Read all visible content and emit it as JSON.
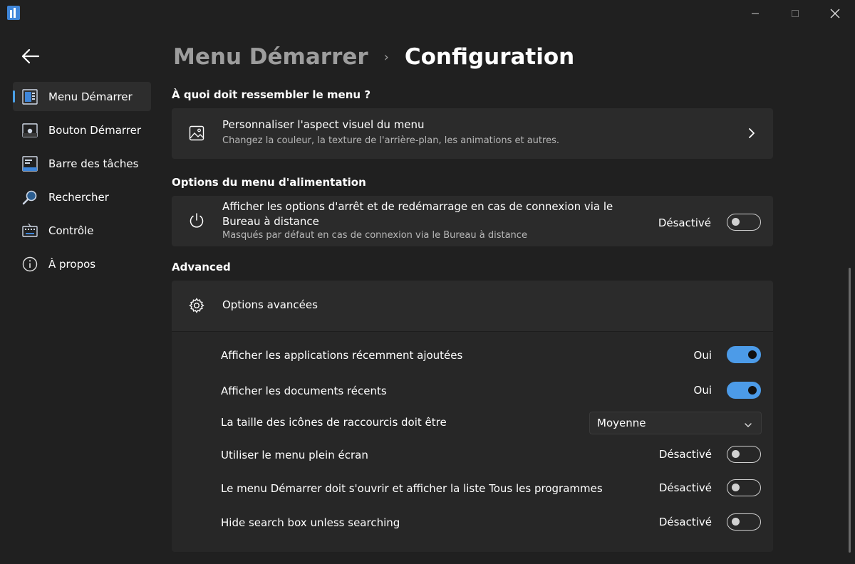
{
  "window": {
    "address_fragment": "https://... \\Startallback\\...",
    "controls": {
      "minimize": "minimize",
      "maximize": "maximize",
      "close": "close"
    }
  },
  "breadcrumb": {
    "parent": "Menu Démarrer",
    "separator": "›",
    "current": "Configuration"
  },
  "sidebar": {
    "items": [
      {
        "label": "Menu Démarrer",
        "icon": "start-menu-icon",
        "selected": true
      },
      {
        "label": "Bouton Démarrer",
        "icon": "start-button-icon",
        "selected": false
      },
      {
        "label": "Barre des tâches",
        "icon": "taskbar-icon",
        "selected": false
      },
      {
        "label": "Rechercher",
        "icon": "search-icon",
        "selected": false
      },
      {
        "label": "Contrôle",
        "icon": "keyboard-icon",
        "selected": false
      },
      {
        "label": "À propos",
        "icon": "info-icon",
        "selected": false
      }
    ]
  },
  "appearance": {
    "heading": "À quoi doit ressembler le menu ?",
    "card_title": "Personnaliser l'aspect visuel du menu",
    "card_desc": "Changez la couleur, la texture de l'arrière-plan, les animations et autres."
  },
  "power": {
    "heading": "Options du menu d'alimentation",
    "title_line1": "Afficher les options d'arrêt et de redémarrage en cas de connexion via le",
    "title_line2": "Bureau à distance",
    "desc": "Masqués par défaut en cas de connexion via le Bureau à distance",
    "state_label": "Désactivé",
    "on": false
  },
  "advanced": {
    "heading": "Advanced",
    "expander_title": "Options avancées",
    "rows": [
      {
        "label": "Afficher les applications récemment ajoutées",
        "state_label": "Oui",
        "on": true
      },
      {
        "label": "Afficher les documents récents",
        "state_label": "Oui",
        "on": true
      },
      {
        "label": "La taille des icônes de raccourcis doit être",
        "dropdown_value": "Moyenne"
      },
      {
        "label": "Utiliser le menu plein écran",
        "state_label": "Désactivé",
        "on": false
      },
      {
        "label": "Le menu Démarrer doit s'ouvrir et afficher la liste Tous les programmes",
        "state_label": "Désactivé",
        "on": false
      },
      {
        "label": "Hide search box unless searching",
        "state_label": "Désactivé",
        "on": false
      }
    ]
  },
  "colors": {
    "accent": "#4c9be8",
    "background": "#202020",
    "card": "#2b2b2b"
  }
}
